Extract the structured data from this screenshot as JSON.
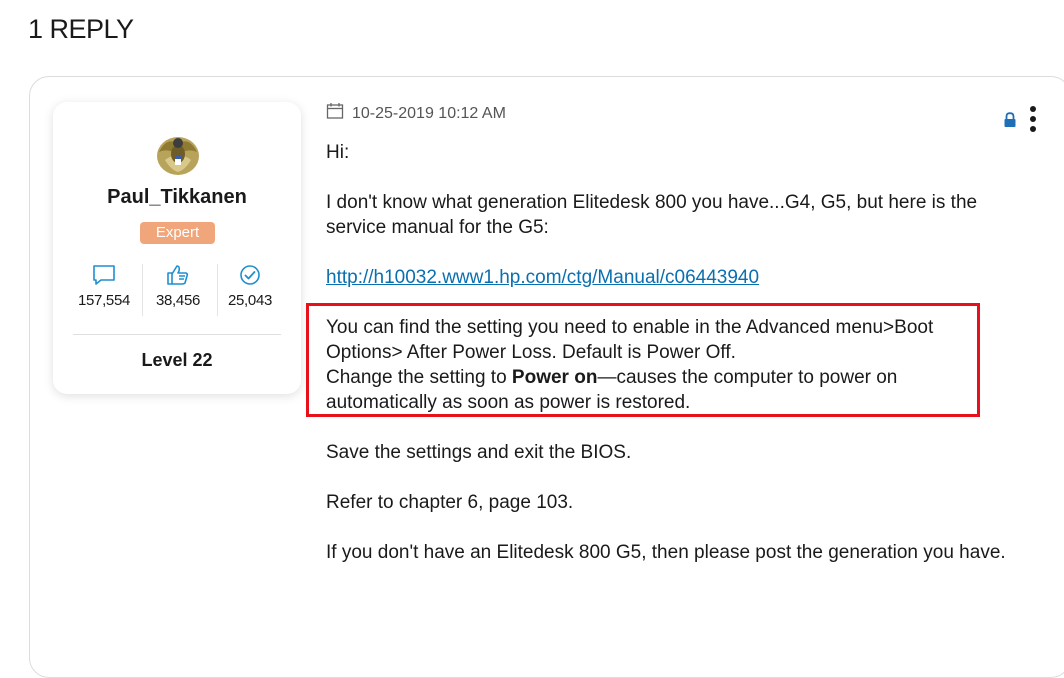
{
  "thread": {
    "reply_count_label": "1 REPLY"
  },
  "author": {
    "name": "Paul_Tikkanen",
    "rank": "Expert",
    "level": "Level 22",
    "stats": {
      "posts": "157,554",
      "kudos": "38,456",
      "solutions": "25,043"
    },
    "avatar_icon": "eagle-emblem-avatar"
  },
  "post": {
    "timestamp": "10-25-2019 10:12 AM",
    "greeting": "Hi:",
    "para1": "I don't know what generation Elitedesk 800 you have...G4, G5, but here is the service manual for the G5:",
    "manual_link": "http://h10032.www1.hp.com/ctg/Manual/c06443940",
    "highlight": {
      "line1": "You can find the setting you need to enable in the Advanced menu>Boot Options> After Power Loss. Default is Power Off.",
      "line2_prefix": "Change the setting to ",
      "line2_bold": "Power on",
      "line2_suffix": "—causes the computer to power on automatically as soon as power is restored."
    },
    "para_save": "Save the settings and exit the BIOS.",
    "para_refer": "Refer to chapter 6, page 103.",
    "para_generation": "If you don't have an Elitedesk 800 G5, then please post the generation you have."
  },
  "colors": {
    "rank_badge": "#f0a67a",
    "link": "#0a6fb0",
    "highlight_border": "#e8101a",
    "stat_icon": "#1f8fd0"
  }
}
